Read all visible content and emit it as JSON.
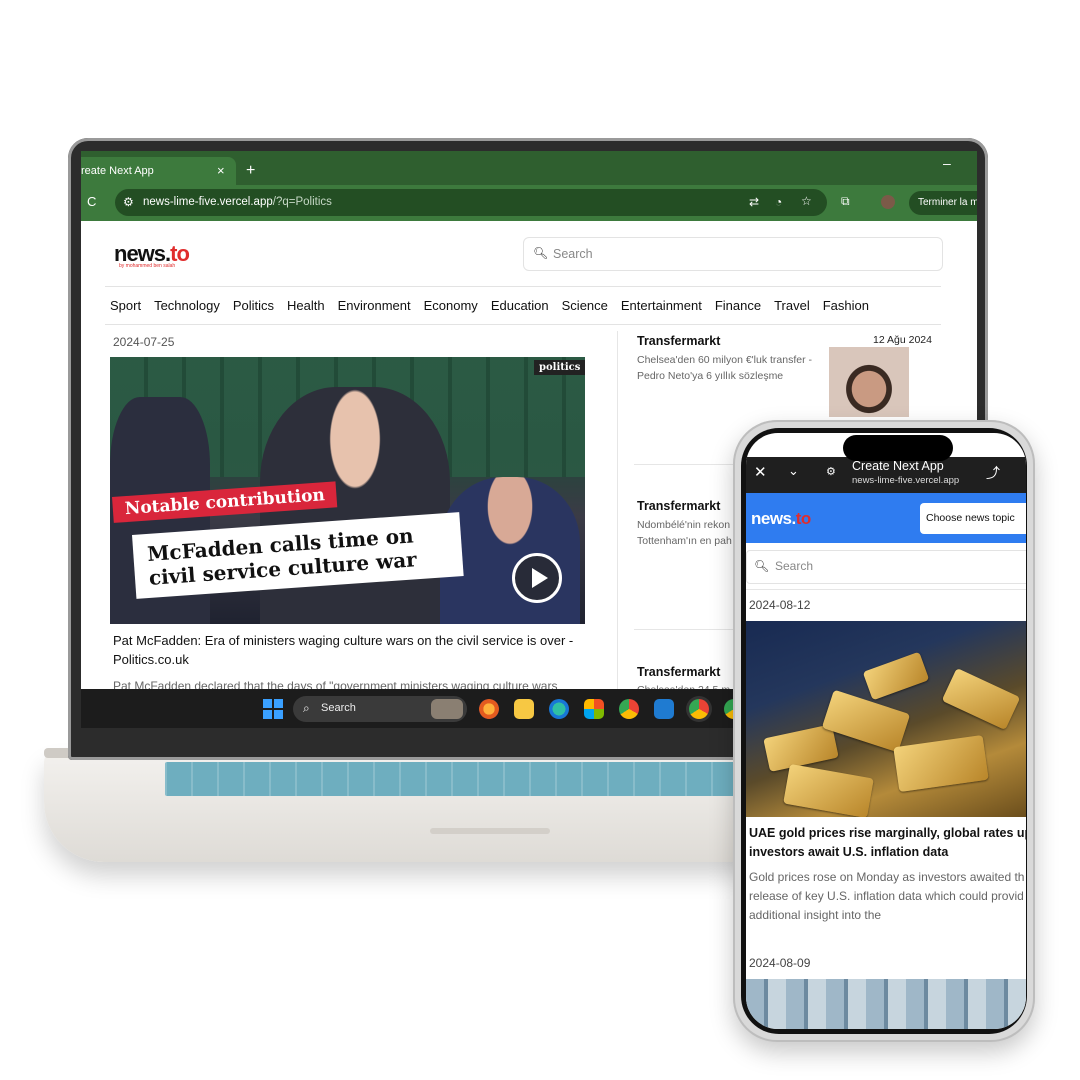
{
  "browser": {
    "tab_title": "reate Next App",
    "tab_close": "×",
    "new_tab": "+",
    "minimize": "–",
    "reload": "C",
    "url_host": "news-lime-five.vercel.app",
    "url_query": "/?q=Politics",
    "terminer_label": "Terminer la mi"
  },
  "site": {
    "logo_main": "news.",
    "logo_accent": "to",
    "logo_sub": "by mohammed ben salah",
    "search_placeholder": "Search",
    "categories": [
      "Sport",
      "Technology",
      "Politics",
      "Health",
      "Environment",
      "Economy",
      "Education",
      "Science",
      "Entertainment",
      "Finance",
      "Travel",
      "Fashion"
    ]
  },
  "main_article": {
    "date": "2024-07-25",
    "image_brand": "politics",
    "image_tag": "Notable contribution",
    "image_headline": "McFadden calls time on civil service culture war",
    "title": "Pat McFadden: Era of ministers waging culture wars on the civil service is over - Politics.co.uk",
    "description": "Pat McFadden declared that the days of \"government ministers waging culture wars"
  },
  "side_articles": [
    {
      "source": "Transfermarkt",
      "date": "12 Ağu 2024",
      "text": "Chelsea'den 60 milyon €'luk transfer - Pedro Neto'ya 6 yıllık sözleşme"
    },
    {
      "source": "Transfermarkt",
      "text": "Ndombélé'nin rekon Tottenham'ın en pah"
    },
    {
      "source": "Transfermarkt",
      "text": "Chelsea'den 24,5 m"
    }
  ],
  "taskbar": {
    "search_label": "Search"
  },
  "phone": {
    "title": "Create Next App",
    "url": "news-lime-five.vercel.app",
    "logo_main": "news.",
    "logo_accent": "to",
    "topic_select": "Choose news topic",
    "search_placeholder": "Search",
    "articles": [
      {
        "date": "2024-08-12",
        "title_line1": "UAE gold prices rise marginally, global rates up a",
        "title_line2": "investors await U.S. inflation data",
        "desc_line1": "Gold prices rose on Monday as investors awaited th",
        "desc_line2": "release of key U.S. inflation data which could provid",
        "desc_line3": "additional insight into the"
      },
      {
        "date": "2024-08-09"
      }
    ]
  },
  "colors": {
    "browser_green": "#3d7a3d",
    "accent_red": "#e02d2d",
    "mobile_header_blue": "#2f7cf0"
  }
}
